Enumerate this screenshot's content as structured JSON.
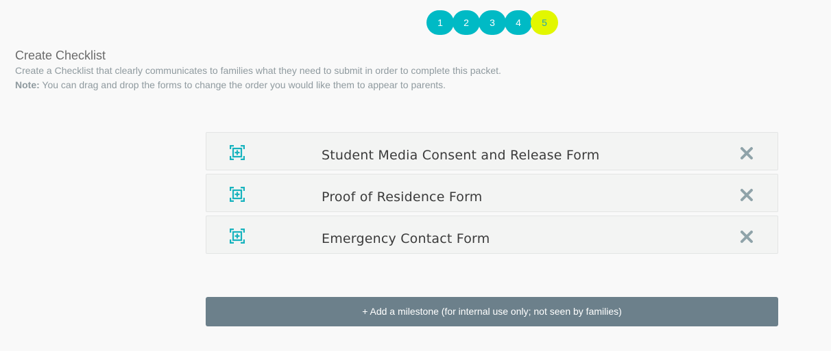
{
  "steps": [
    "1",
    "2",
    "3",
    "4",
    "5"
  ],
  "active_step": "5",
  "header": {
    "title": "Create Checklist",
    "description": "Create a Checklist that clearly communicates to families what they need to submit in order to complete this packet.",
    "note_label": "Note:",
    "note_text": " You can drag and drop the forms to change the order you would like them to appear to parents."
  },
  "forms": [
    {
      "label": "Student Media Consent and Release Form",
      "drag_icon": "drag-move-icon",
      "remove_icon": "close-icon"
    },
    {
      "label": "Proof of Residence Form",
      "drag_icon": "drag-move-icon",
      "remove_icon": "close-icon"
    },
    {
      "label": "Emergency Contact Form",
      "drag_icon": "drag-move-icon",
      "remove_icon": "close-icon"
    }
  ],
  "milestone_button": {
    "label": "+ Add a milestone (for internal use only; not seen by families)"
  },
  "colors": {
    "step": "#00bac5",
    "step_active": "#e2f700",
    "accent_icon": "#17b3be",
    "remove_icon": "#8fa3a9",
    "button": "#6c808b"
  }
}
